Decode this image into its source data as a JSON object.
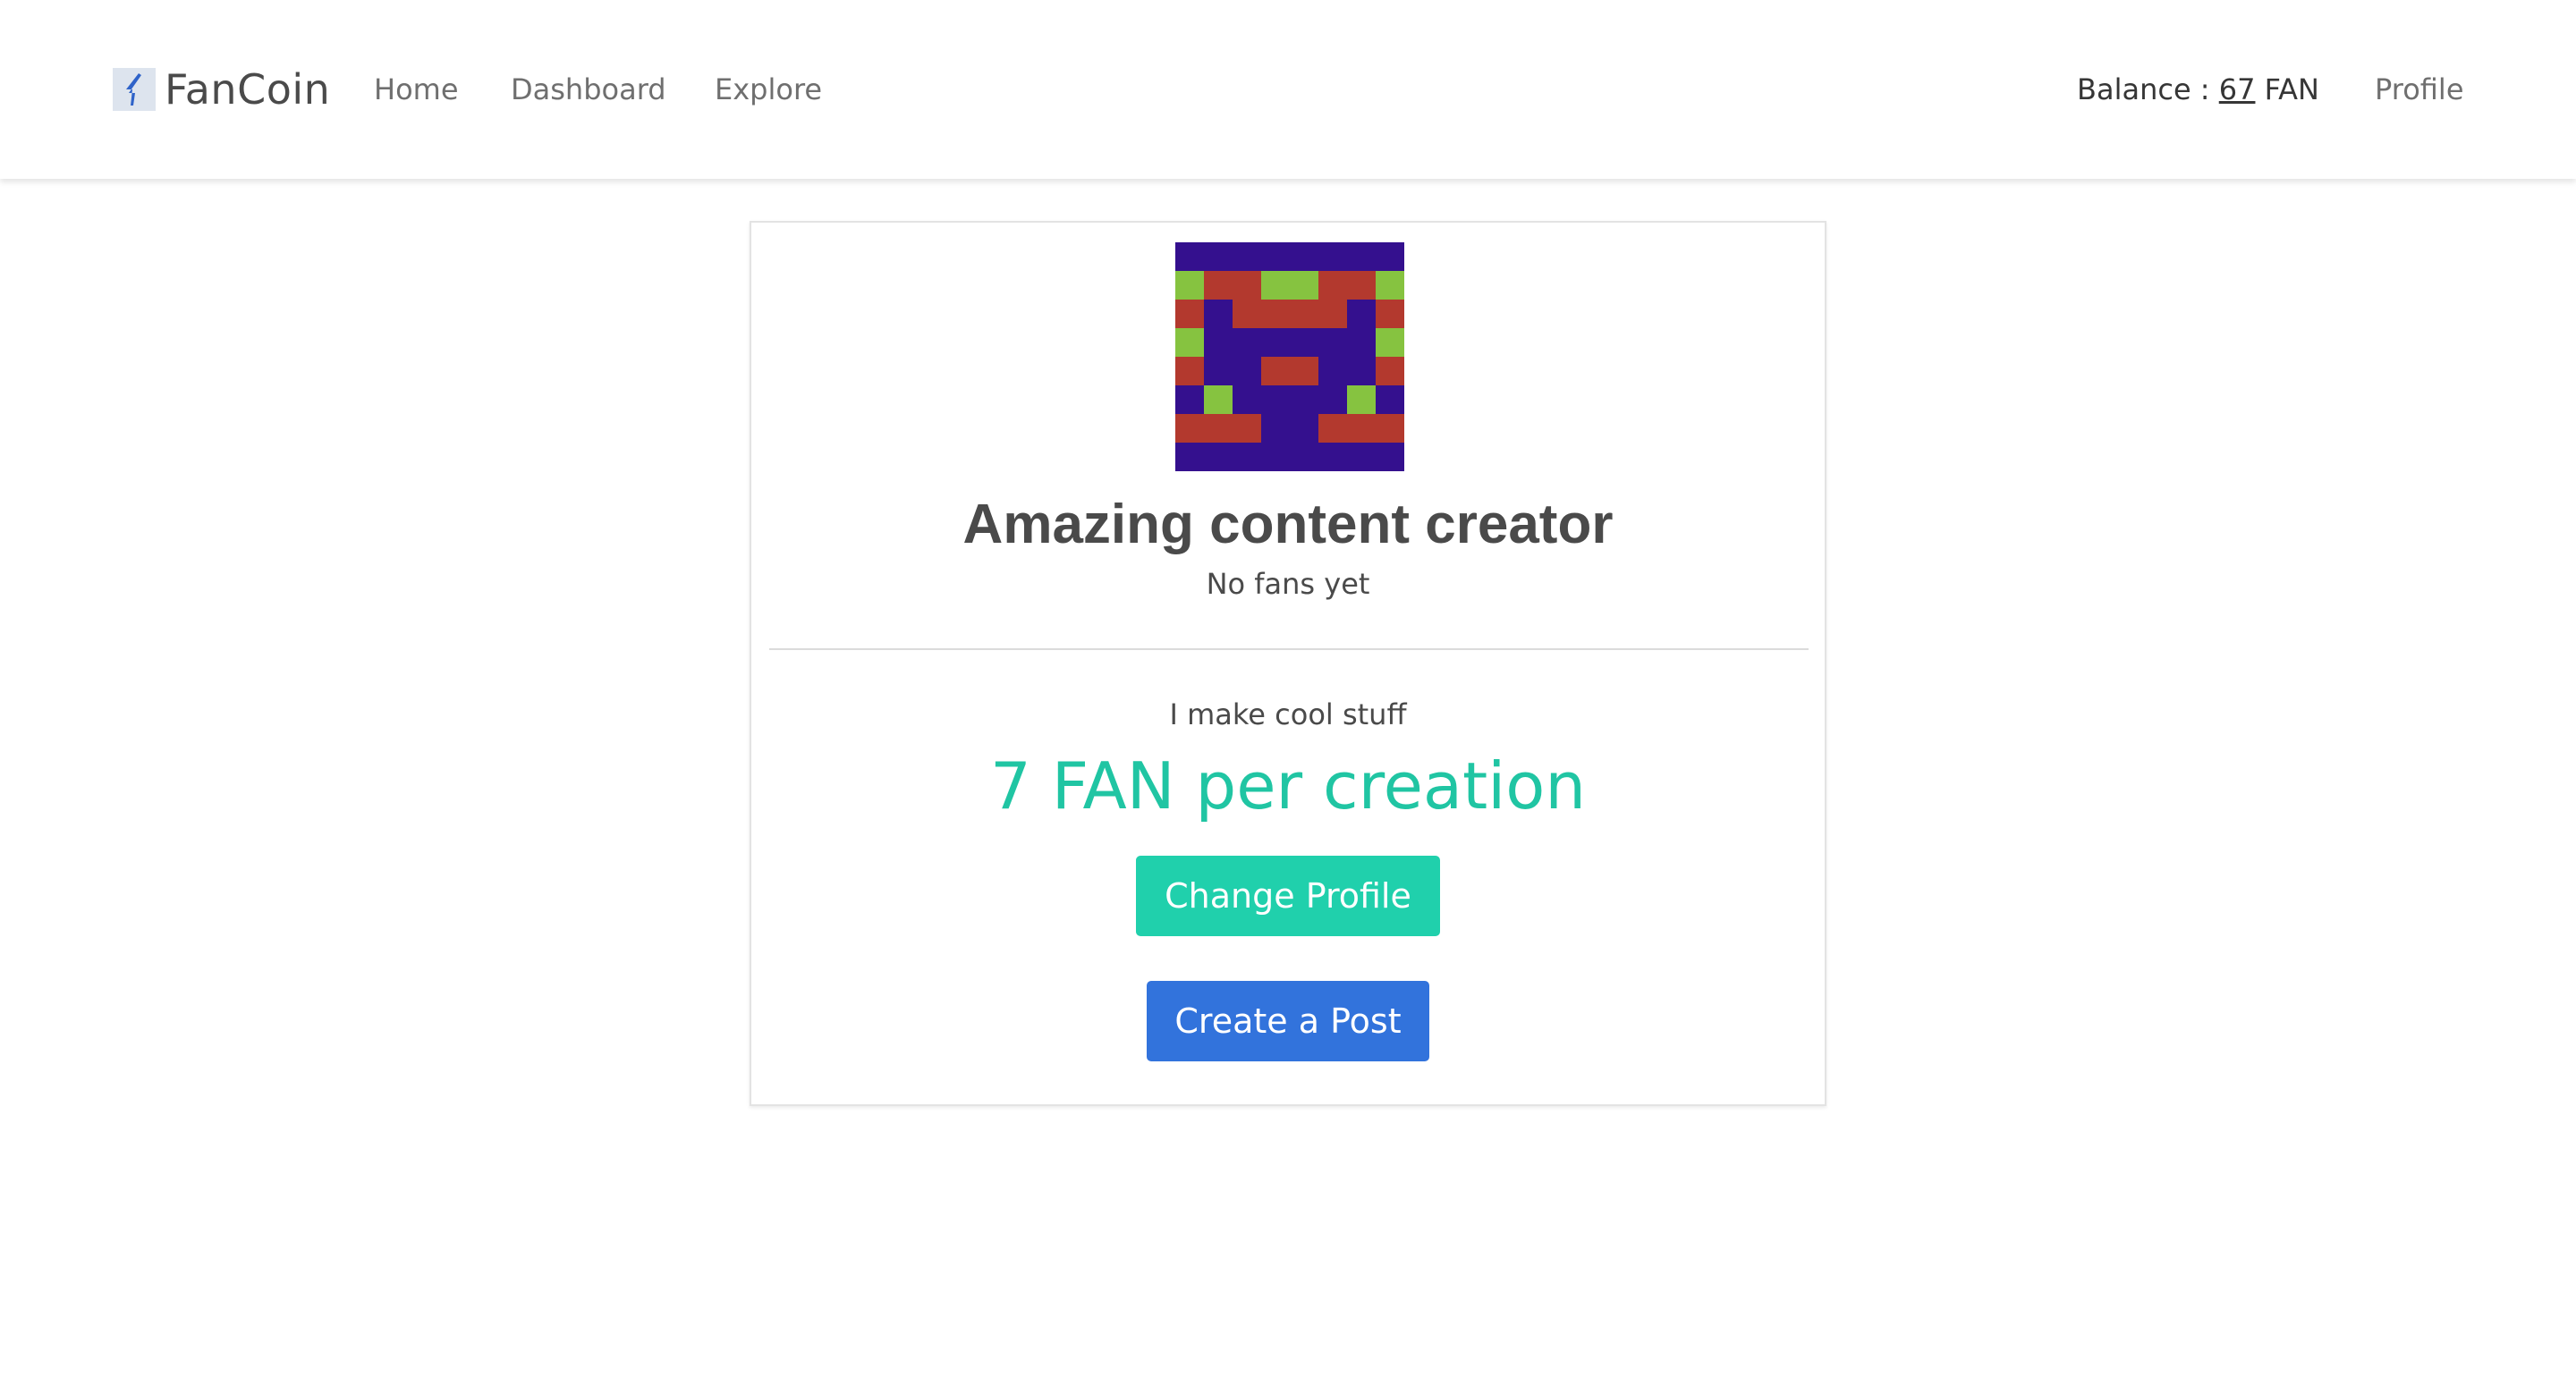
{
  "navbar": {
    "brand": "FanCoin",
    "brand_icon": "fancoin-logo-icon",
    "links": {
      "home": "Home",
      "dashboard": "Dashboard",
      "explore": "Explore",
      "profile": "Profile"
    },
    "balance": {
      "label": "Balance : ",
      "amount": "67",
      "unit": " FAN"
    }
  },
  "profile": {
    "avatar_icon": "identicon-avatar",
    "name": "Amazing content creator",
    "fans": "No fans yet",
    "bio": "I make cool stuff",
    "price": "7 FAN per creation",
    "change_profile_label": "Change Profile",
    "create_post_label": "Create a Post"
  },
  "colors": {
    "accent_primary": "#20d0ac",
    "accent_link": "#3273dc",
    "price_text": "#20c5a3",
    "avatar_background": "#34108e",
    "avatar_red": "#b3392e",
    "avatar_green": "#86c340"
  }
}
